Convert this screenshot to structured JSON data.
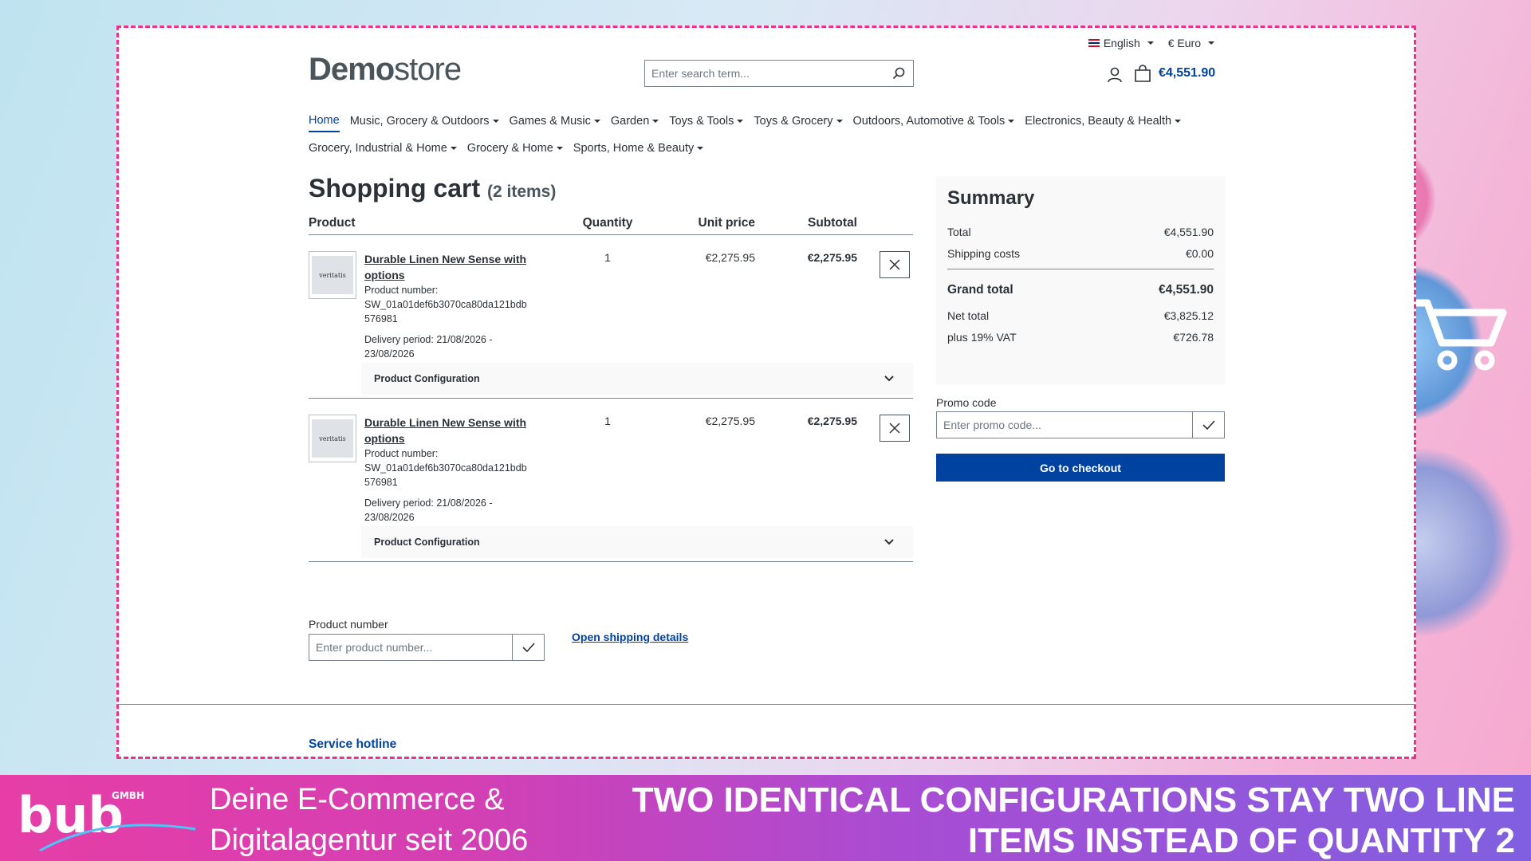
{
  "topbar": {
    "language": "English",
    "currency": "€ Euro"
  },
  "header": {
    "logo_bold": "Demo",
    "logo_light": "store",
    "search_placeholder": "Enter search term...",
    "cart_total": "€4,551.90"
  },
  "nav": {
    "row1": [
      {
        "label": "Home",
        "active": true,
        "caret": false
      },
      {
        "label": "Music, Grocery & Outdoors",
        "caret": true
      },
      {
        "label": "Games & Music",
        "caret": true
      },
      {
        "label": "Garden",
        "caret": true
      },
      {
        "label": "Toys & Tools",
        "caret": true
      },
      {
        "label": "Toys & Grocery",
        "caret": true
      },
      {
        "label": "Outdoors, Automotive & Tools",
        "caret": true
      },
      {
        "label": "Electronics, Beauty & Health",
        "caret": true
      }
    ],
    "row2": [
      {
        "label": "Grocery, Industrial & Home",
        "caret": true
      },
      {
        "label": "Grocery & Home",
        "caret": true
      },
      {
        "label": "Sports, Home & Beauty",
        "caret": true
      }
    ]
  },
  "cart": {
    "title": "Shopping cart",
    "count": "(2 items)",
    "columns": {
      "product": "Product",
      "quantity": "Quantity",
      "unit_price": "Unit price",
      "subtotal": "Subtotal"
    },
    "items": [
      {
        "image_text": "veritatis",
        "name_line1": "Durable Linen New Sense with",
        "name_line2": "options",
        "number_label": "Product number:",
        "number_line1": "SW_01a01def6b3070ca80da121bdb",
        "number_line2": "576981",
        "delivery_line1": "Delivery period: 21/08/2026 -",
        "delivery_line2": "23/08/2026",
        "quantity": "1",
        "unit_price": "€2,275.95",
        "subtotal": "€2,275.95",
        "config_label": "Product Configuration"
      },
      {
        "image_text": "veritatis",
        "name_line1": "Durable Linen New Sense with",
        "name_line2": "options",
        "number_label": "Product number:",
        "number_line1": "SW_01a01def6b3070ca80da121bdb",
        "number_line2": "576981",
        "delivery_line1": "Delivery period: 21/08/2026 -",
        "delivery_line2": "23/08/2026",
        "quantity": "1",
        "unit_price": "€2,275.95",
        "subtotal": "€2,275.95",
        "config_label": "Product Configuration"
      }
    ],
    "product_number_label": "Product number",
    "product_number_placeholder": "Enter product number...",
    "shipping_link": "Open shipping details"
  },
  "summary": {
    "title": "Summary",
    "total_label": "Total",
    "total_value": "€4,551.90",
    "shipping_label": "Shipping costs",
    "shipping_value": "€0.00",
    "grand_label": "Grand total",
    "grand_value": "€4,551.90",
    "net_label": "Net total",
    "net_value": "€3,825.12",
    "vat_label": "plus 19% VAT",
    "vat_value": "€726.78",
    "promo_label": "Promo code",
    "promo_placeholder": "Enter promo code...",
    "checkout_label": "Go to checkout"
  },
  "footer": {
    "hotline": "Service hotline"
  },
  "banner": {
    "brand": "bub",
    "brand_suffix": "GMBH",
    "tagline_line1": "Deine E-Commerce &",
    "tagline_line2": "Digitalagentur seit 2006",
    "headline_line1": "TWO IDENTICAL CONFIGURATIONS STAY TWO LINE",
    "headline_line2": "ITEMS INSTEAD OF QUANTITY 2"
  },
  "colors": {
    "primary": "#0042a0",
    "frame_dash": "#e8338d",
    "banner_start": "#e63ea6",
    "banner_end": "#8060e0"
  }
}
